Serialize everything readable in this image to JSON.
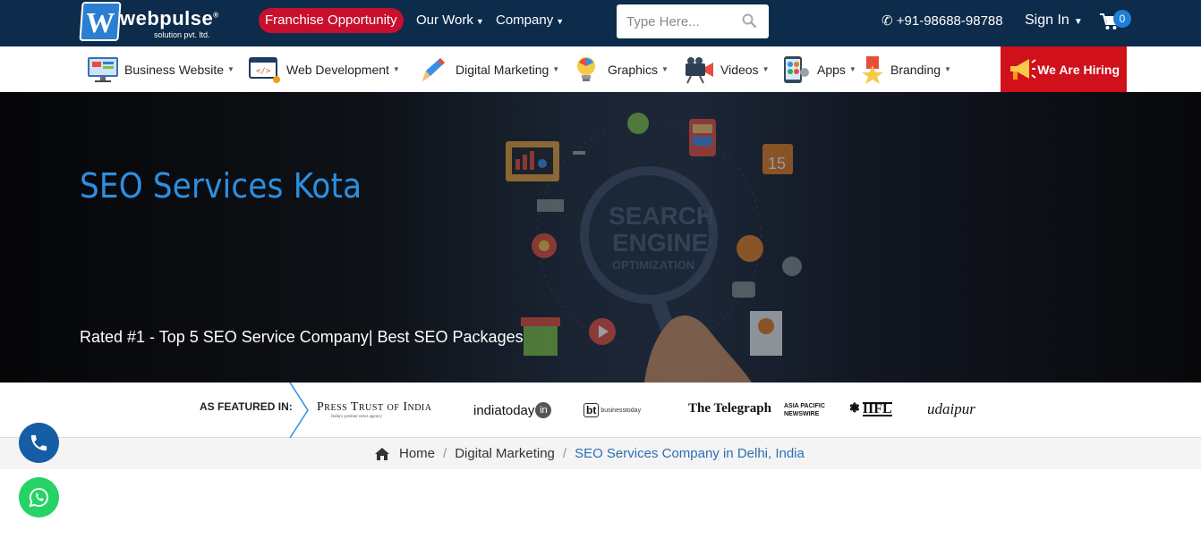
{
  "header": {
    "logo": {
      "brand": "webpulse",
      "tagline": "solution pvt. ltd."
    },
    "franchise_label": "Franchise Opportunity",
    "nav": [
      {
        "label": "Our Work"
      },
      {
        "label": "Company"
      }
    ],
    "search": {
      "placeholder": "Type Here..."
    },
    "phone": "+91-98688-98788",
    "sign_in": "Sign In",
    "cart_count": "0"
  },
  "categories": [
    {
      "label": "Business Website",
      "icon": "monitor-icon"
    },
    {
      "label": "Web Development",
      "icon": "code-window-icon"
    },
    {
      "label": "Digital Marketing",
      "icon": "pencil-icon"
    },
    {
      "label": "Graphics",
      "icon": "lightbulb-icon"
    },
    {
      "label": "Videos",
      "icon": "video-camera-icon"
    },
    {
      "label": "Apps",
      "icon": "mobile-app-icon"
    },
    {
      "label": "Branding",
      "icon": "star-ribbon-icon"
    }
  ],
  "hiring_label": "We Are Hiring",
  "hero": {
    "title": "SEO Services Kota",
    "subtitle": "Rated #1 - Top 5 SEO Service Company| Best SEO Packages",
    "art_words": [
      "SEARCH",
      "ENGINE",
      "OPTIMIZATION"
    ]
  },
  "featured": {
    "label": "AS FEATURED IN:",
    "logos": [
      {
        "text": "Press Trust of India",
        "subtext": "India's premier news agency"
      },
      {
        "text": "indiatoday",
        "badge": "in"
      },
      {
        "text": "businesstoday",
        "badge": "bt"
      },
      {
        "text": "The Telegraph"
      },
      {
        "text": "ASIA PACIFIC NEWSWIRE"
      },
      {
        "text": "IIFL"
      },
      {
        "text": "udaipur"
      }
    ]
  },
  "breadcrumb": [
    {
      "label": "Home"
    },
    {
      "label": "Digital Marketing"
    },
    {
      "label": "SEO Services Company in Delhi, India"
    }
  ],
  "colors": {
    "topbar": "#0d2b4a",
    "franchise": "#c8102e",
    "hiring": "#d0101a",
    "hero_title": "#2d8fe0",
    "breadcrumb_active": "#2a6fb5",
    "call_button": "#155ea6",
    "whatsapp_button": "#25d366"
  }
}
